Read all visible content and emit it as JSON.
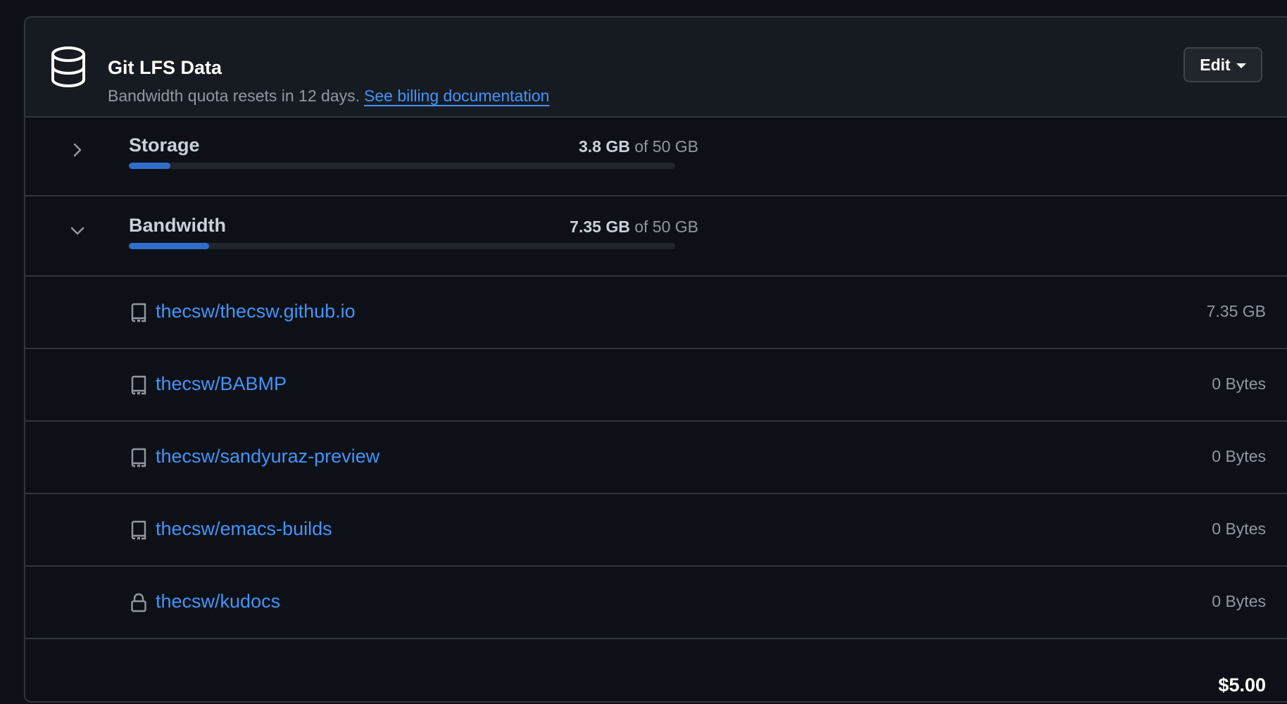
{
  "header": {
    "title": "Git LFS Data",
    "subtitle": "Bandwidth quota resets in 12 days.",
    "billing_link": "See billing documentation",
    "edit_label": "Edit",
    "icon": "database-icon"
  },
  "storage": {
    "label": "Storage",
    "used": "3.8 GB",
    "of_text": "of 50 GB",
    "fraction": 0.076,
    "expanded": false
  },
  "bandwidth": {
    "label": "Bandwidth",
    "used": "7.35 GB",
    "of_text": "of 50 GB",
    "fraction": 0.147,
    "expanded": true
  },
  "repos": [
    {
      "name": "thecsw/thecsw.github.io",
      "size": "7.35 GB",
      "icon": "repo-icon"
    },
    {
      "name": "thecsw/BABMP",
      "size": "0 Bytes",
      "icon": "repo-icon"
    },
    {
      "name": "thecsw/sandyuraz-preview",
      "size": "0 Bytes",
      "icon": "repo-icon"
    },
    {
      "name": "thecsw/emacs-builds",
      "size": "0 Bytes",
      "icon": "repo-icon"
    },
    {
      "name": "thecsw/kudocs",
      "size": "0 Bytes",
      "icon": "lock-icon"
    }
  ],
  "total": "$5.00",
  "colors": {
    "accent": "#4493f8",
    "bar": "#316dca",
    "background": "#0d1117",
    "header_bg": "#161b22"
  }
}
